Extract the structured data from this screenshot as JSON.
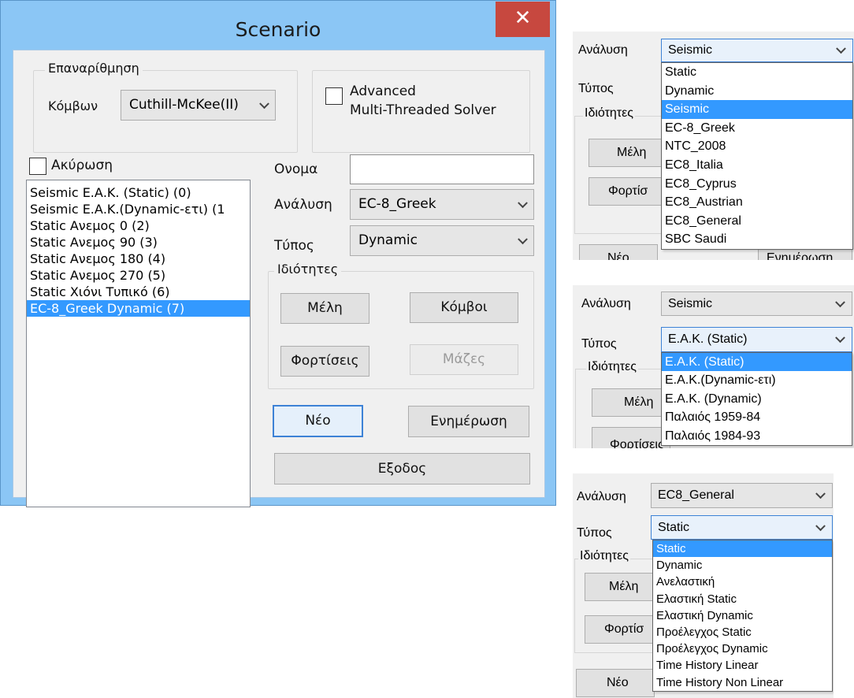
{
  "dialog": {
    "title": "Scenario",
    "close_glyph": "✕",
    "renumber_group": {
      "title": "Επαναρίθμηση",
      "nodes_label": "Κόμβων",
      "nodes_value": "Cuthill-McKee(II)"
    },
    "advanced": {
      "line1": "Advanced",
      "line2": "Multi-Threaded Solver",
      "checked": false
    },
    "cancel_checkbox_label": "Ακύρωση",
    "scenarios": [
      "Seismic Ε.Α.Κ. (Static) (0)",
      "Seismic Ε.Α.Κ.(Dynamic-ετι) (1",
      "Static Ανεμος 0 (2)",
      "Static Ανεμος 90 (3)",
      "Static Ανεμος 180 (4)",
      "Static Ανεμος 270 (5)",
      "Static Χιόνι Τυπικό (6)",
      "EC-8_Greek Dynamic (7)"
    ],
    "selected_scenario_index": 7,
    "name_label": "Ονομα",
    "name_value": "",
    "analysis_label": "Ανάλυση",
    "analysis_value": "EC-8_Greek",
    "type_label": "Τύπος",
    "type_value": "Dynamic",
    "properties_group": {
      "title": "Ιδιότητες",
      "members": "Μέλη",
      "nodes": "Κόμβοι",
      "loads": "Φορτίσεις",
      "masses": "Μάζες"
    },
    "new_button": "Νέο",
    "update_button": "Ενημέρωση",
    "exit_button": "Εξοδος"
  },
  "panel_analysis": {
    "analysis_label": "Ανάλυση",
    "analysis_value": "Seismic",
    "type_label": "Τύπος",
    "properties_label": "Ιδιότητες",
    "members_partial": "Μέλη",
    "loads_partial": "Φορτίσ",
    "new_partial": "Νέο",
    "update_partial": "Ενημέρωση",
    "options": [
      "Static",
      "Dynamic",
      "Seismic",
      "EC-8_Greek",
      "NTC_2008",
      "EC8_Italia",
      "EC8_Cyprus",
      "EC8_Austrian",
      "EC8_General",
      "SBC Saudi"
    ],
    "selected_index": 2
  },
  "panel_seismic_type": {
    "analysis_label": "Ανάλυση",
    "analysis_value": "Seismic",
    "type_label": "Τύπος",
    "type_value": "E.A.K. (Static)",
    "properties_label": "Ιδιότητες",
    "members_partial": "Μέλη",
    "loads_partial": "Φορτίσεις",
    "options": [
      "E.A.K. (Static)",
      "E.A.K.(Dynamic-ετι)",
      "E.A.K. (Dynamic)",
      "Παλαιός 1959-84",
      "Παλαιός 1984-93"
    ],
    "selected_index": 0
  },
  "panel_ec8_type": {
    "analysis_label": "Ανάλυση",
    "analysis_value": "EC8_General",
    "type_label": "Τύπος",
    "type_value": "Static",
    "properties_label": "Ιδιότητες",
    "members_partial": "Μέλη",
    "loads_partial": "Φορτίσ",
    "new_partial": "Νέο",
    "options": [
      "Static",
      "Dynamic",
      "Ανελαστική",
      "Ελαστική Static",
      "Ελαστική Dynamic",
      "Προέλεγχος Static",
      "Προέλεγχος Dynamic",
      "Time History Linear",
      "Time History Non Linear"
    ],
    "selected_index": 0
  }
}
